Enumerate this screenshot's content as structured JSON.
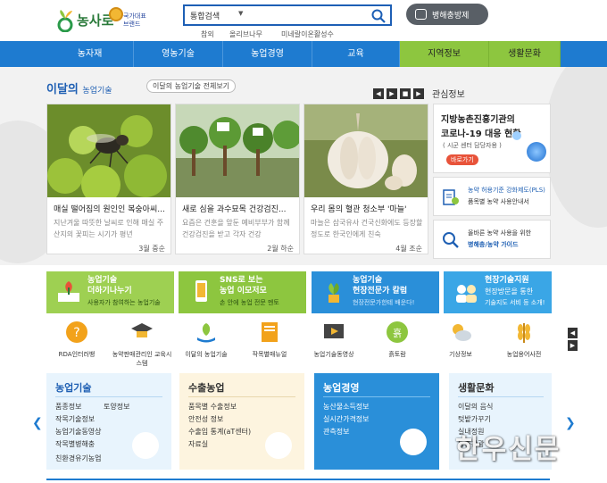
{
  "header": {
    "logo_text": "농사로",
    "logo_sub": "국가대표 브랜드",
    "search_label": "통합검색",
    "keywords": [
      "참외",
      "올리브나무",
      "미네랄이온활성수"
    ],
    "pest_button": "병해충방제"
  },
  "nav": [
    "농자재",
    "영농기술",
    "농업경영",
    "교육",
    "지역정보",
    "생활문화"
  ],
  "featured": {
    "title_main": "이달의",
    "title_sub": "농업기술",
    "all_button": "이달의 농업기술 전체보기",
    "controls": [
      "◀",
      "▶",
      "■",
      "▶"
    ],
    "cards": [
      {
        "title": "매실 떨어짐의 원인인 복숭아씨...",
        "desc": "지난겨울 따뜻한 날씨로 인해 매실 주산지의 꽃피는 시기가 평년",
        "date": "3월 중순"
      },
      {
        "title": "새로 심을 과수묘목 건강검진...",
        "desc": "요즘은 건훈을 앞둔 예비부부가 함께 건강검진을 받고 각자 건강",
        "date": "2월 하순"
      },
      {
        "title": "우리 몸의 혈관 청소부 '마늘'",
        "desc": "마늘은 삼국유사 건국신화에도 등장할 정도로 한국인에게 친숙",
        "date": "4월 조순"
      }
    ]
  },
  "interest": {
    "title": "관심정보",
    "covid_line1": "지방농촌진흥기관의",
    "covid_line2": "코로나-19 대응 현황",
    "covid_line3": "( 시군 센터 담당자용 )",
    "covid_go": "바로가기",
    "info": [
      {
        "a": "농약 허용기준 강화제도(PLS)",
        "b": "품목별 농약 사용안내서"
      },
      {
        "a": "올바른 농약 사용을 위한",
        "b": "병해충/농약 가이드"
      }
    ]
  },
  "banners": [
    {
      "l1": "농업기술",
      "l2": "더하기나누기",
      "l3": "사용자가 참여하는 농업기술"
    },
    {
      "l1": "SNS로 보는",
      "l2": "농업 이모저모",
      "l3": "손 안에 농업 전문 멘토"
    },
    {
      "l1": "농업기술",
      "l2": "현장전문가 칼럼",
      "l3": "현장전문가한테 배운다!"
    },
    {
      "l1": "현장기술지원",
      "l2": "현장방문을 통한",
      "l3": "기술지도 서비 등 소개!"
    }
  ],
  "quick": [
    "RDA인터러뱅",
    "농약판매관리인 교육시스템",
    "이달의 농업기술",
    "작목별매뉴얼",
    "농업기술동영상",
    "흙토람",
    "기상정보",
    "농업용어사전"
  ],
  "categories": [
    {
      "title": "농업기술",
      "items": [
        "품종정보",
        "토양정보",
        "작목기술정보",
        "농업기술동영상",
        "작목별병해충",
        "친환경유기농업"
      ]
    },
    {
      "title": "수출농업",
      "items": [
        "품목별 수출정보",
        "안전성 정보",
        "수출입 통계(aT센터)",
        "자료실"
      ]
    },
    {
      "title": "농업경영",
      "items": [
        "농산물소득정보",
        "실시간가격정보",
        "관측정보"
      ]
    },
    {
      "title": "생활문화",
      "items": [
        "이달의 음식",
        "텃밭가꾸기",
        "실내정원",
        "농촌관광"
      ]
    }
  ],
  "watermark": "한우신문",
  "colors": {
    "nav_blue": "#1e7bd0",
    "nav_green": "#8dc63f",
    "accent_red": "#e8533a"
  }
}
